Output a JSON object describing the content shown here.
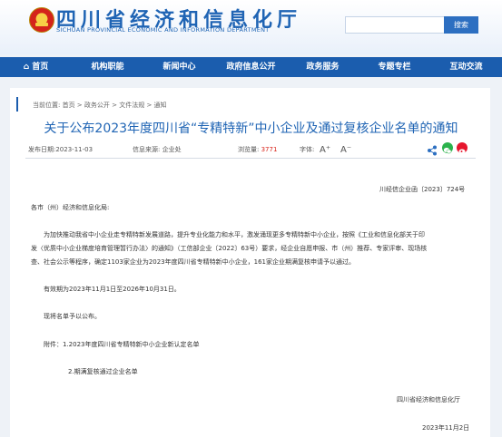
{
  "header": {
    "title": "四川省经济和信息化厅",
    "subtitle": "SICHUAN PROVINCIAL ECONOMIC AND INFORMATION DEPARTMENT",
    "search_button": "搜索"
  },
  "nav": [
    "首页",
    "机构职能",
    "新闻中心",
    "政府信息公开",
    "政务服务",
    "专题专栏",
    "互动交流"
  ],
  "breadcrumb": "当前位置: 首页 > 政务公开 > 文件法规 > 通知",
  "article": {
    "title": "关于公布2023年度四川省“专精特新”中小企业及通过复核企业名单的通知",
    "publish_date": "发布日期:2023-11-03",
    "source": "信息来源: 企业处",
    "views_label": "浏览量:",
    "views": "3771",
    "font_label": "字体:",
    "font_larger": "A⁺",
    "font_smaller": "A⁻",
    "doc_number": "川经信企业函〔2023〕724号",
    "salutation": "各市（州）经济和信息化局:",
    "para1_line1": "为加快推动我省中小企业走专精特新发展道路，提升专业化能力和水平，激发涌现更多专精特新中小企业，按照《工业和信息化部关于印",
    "para1_line2": "发〈优质中小企业梯度培育管理暂行办法〉的通知》（工信部企业〔2022〕63号）要求，经企业自愿申报、市（州）推荐、专家评审、现场核",
    "para1_line3": "查、社会公示等程序，确定1103家企业为2023年度四川省专精特新中小企业，161家企业期满复核申请予以通过。",
    "para2": "有效期为2023年11月1日至2026年10月31日。",
    "para3": "现将名单予以公布。",
    "attachment1": "附件：1.2023年度四川省专精特新中小企业新认定名单",
    "attachment2": "2.期满复核通过企业名单",
    "signature": "四川省经济和信息化厅",
    "date": "2023年11月2日"
  },
  "colors": {
    "brand": "#1b5dae",
    "title": "#1f64b4",
    "highlight": "#d9261c"
  }
}
